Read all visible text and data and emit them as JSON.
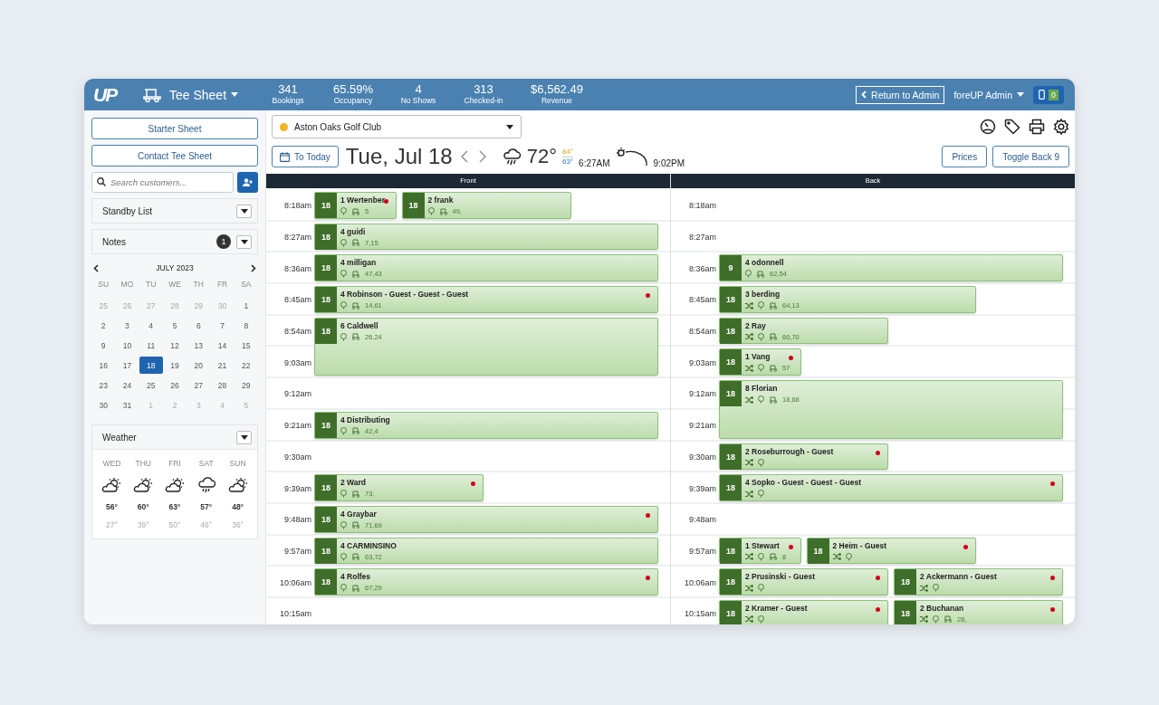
{
  "header": {
    "logo": "UP",
    "app_menu": "Tee Sheet",
    "stats": [
      {
        "value": "341",
        "label": "Bookings"
      },
      {
        "value": "65.59%",
        "label": "Occupancy"
      },
      {
        "value": "4",
        "label": "No Shows"
      },
      {
        "value": "313",
        "label": "Checked-in"
      },
      {
        "value": "$6,562.49",
        "label": "Revenue"
      }
    ],
    "return_button": "Return to Admin",
    "user_menu": "foreUP Admin",
    "device_count": "0"
  },
  "sidebar": {
    "buttons": [
      "Starter Sheet",
      "Contact Tee Sheet"
    ],
    "search": {
      "placeholder": "Search customers..."
    },
    "panels": [
      {
        "title": "Standby List"
      },
      {
        "title": "Notes",
        "count": "1"
      }
    ],
    "calendar": {
      "month": "JULY  2023",
      "weekdays": [
        "SU",
        "MO",
        "TU",
        "WE",
        "TH",
        "FR",
        "SA"
      ],
      "days": [
        {
          "label": "25",
          "muted": true,
          "selected": false
        },
        {
          "label": "26",
          "muted": true,
          "selected": false
        },
        {
          "label": "27",
          "muted": true,
          "selected": false
        },
        {
          "label": "28",
          "muted": true,
          "selected": false
        },
        {
          "label": "29",
          "muted": true,
          "selected": false
        },
        {
          "label": "30",
          "muted": true,
          "selected": false
        },
        {
          "label": "1",
          "muted": false,
          "selected": false
        },
        {
          "label": "2",
          "muted": false,
          "selected": false
        },
        {
          "label": "3",
          "muted": false,
          "selected": false
        },
        {
          "label": "4",
          "muted": false,
          "selected": false
        },
        {
          "label": "5",
          "muted": false,
          "selected": false
        },
        {
          "label": "6",
          "muted": false,
          "selected": false
        },
        {
          "label": "7",
          "muted": false,
          "selected": false
        },
        {
          "label": "8",
          "muted": false,
          "selected": false
        },
        {
          "label": "9",
          "muted": false,
          "selected": false
        },
        {
          "label": "10",
          "muted": false,
          "selected": false
        },
        {
          "label": "11",
          "muted": false,
          "selected": false
        },
        {
          "label": "12",
          "muted": false,
          "selected": false
        },
        {
          "label": "13",
          "muted": false,
          "selected": false
        },
        {
          "label": "14",
          "muted": false,
          "selected": false
        },
        {
          "label": "15",
          "muted": false,
          "selected": false
        },
        {
          "label": "16",
          "muted": false,
          "selected": false
        },
        {
          "label": "17",
          "muted": false,
          "selected": false
        },
        {
          "label": "18",
          "muted": false,
          "selected": true
        },
        {
          "label": "19",
          "muted": false,
          "selected": false
        },
        {
          "label": "20",
          "muted": false,
          "selected": false
        },
        {
          "label": "21",
          "muted": false,
          "selected": false
        },
        {
          "label": "22",
          "muted": false,
          "selected": false
        },
        {
          "label": "23",
          "muted": false,
          "selected": false
        },
        {
          "label": "24",
          "muted": false,
          "selected": false
        },
        {
          "label": "25",
          "muted": false,
          "selected": false
        },
        {
          "label": "26",
          "muted": false,
          "selected": false
        },
        {
          "label": "27",
          "muted": false,
          "selected": false
        },
        {
          "label": "28",
          "muted": false,
          "selected": false
        },
        {
          "label": "29",
          "muted": false,
          "selected": false
        },
        {
          "label": "30",
          "muted": false,
          "selected": false
        },
        {
          "label": "31",
          "muted": false,
          "selected": false
        },
        {
          "label": "1",
          "muted": true,
          "selected": false
        },
        {
          "label": "2",
          "muted": true,
          "selected": false
        },
        {
          "label": "3",
          "muted": true,
          "selected": false
        },
        {
          "label": "4",
          "muted": true,
          "selected": false
        },
        {
          "label": "5",
          "muted": true,
          "selected": false
        }
      ]
    },
    "weather": {
      "title": "Weather",
      "days": [
        {
          "day": "WED",
          "kind": "partly_cloudy",
          "high": "56°",
          "low": "27°"
        },
        {
          "day": "THU",
          "kind": "partly_cloudy",
          "high": "60°",
          "low": "39°"
        },
        {
          "day": "FRI",
          "kind": "partly_cloudy",
          "high": "63°",
          "low": "50°"
        },
        {
          "day": "SAT",
          "kind": "rain",
          "high": "57°",
          "low": "46°"
        },
        {
          "day": "SUN",
          "kind": "partly_cloudy",
          "high": "48°",
          "low": "36°"
        }
      ]
    }
  },
  "toolbar": {
    "course": {
      "name": "Aston Oaks Golf Club",
      "color": "#f0b429"
    },
    "today_button": "To Today",
    "date": "Tue, Jul 18",
    "temperature": "72°",
    "high": "84°",
    "low": "63°",
    "sunrise": "6:27AM",
    "sunset": "9:02PM",
    "buttons": [
      "Prices",
      "Toggle Back 9"
    ]
  },
  "sheet": {
    "columns": [
      {
        "title": "Front",
        "rows": [
          {
            "time": "8:18am",
            "bookings": [
              {
                "holes": "18",
                "name": "1 Wertenber",
                "kind": "quarter",
                "flag": true,
                "shuffle": false,
                "cart": "5"
              },
              {
                "holes": "18",
                "name": "2 frank",
                "kind": "half",
                "flag": false,
                "shuffle": false,
                "cart": "49,"
              }
            ]
          },
          {
            "time": "8:27am",
            "bookings": [
              {
                "holes": "18",
                "name": "4 guidi",
                "kind": "full",
                "flag": false,
                "shuffle": false,
                "cart": "7,15"
              }
            ]
          },
          {
            "time": "8:36am",
            "bookings": [
              {
                "holes": "18",
                "name": "4 milligan",
                "kind": "full",
                "flag": false,
                "shuffle": false,
                "cart": "47,43"
              }
            ]
          },
          {
            "time": "8:45am",
            "bookings": [
              {
                "holes": "18",
                "name": "4 Robinson - Guest - Guest - Guest",
                "kind": "full",
                "flag": true,
                "shuffle": false,
                "cart": "14,61"
              }
            ]
          },
          {
            "time": "8:54am",
            "bookings": [
              {
                "holes": "18",
                "name": "6 Caldwell",
                "kind": "double",
                "flag": false,
                "shuffle": false,
                "cart": "26,24"
              }
            ]
          },
          {
            "time": "9:03am"
          },
          {
            "time": "9:12am"
          },
          {
            "time": "9:21am",
            "bookings": [
              {
                "holes": "18",
                "name": "4 Distributing",
                "kind": "full",
                "flag": false,
                "shuffle": false,
                "cart": "42,4"
              }
            ]
          },
          {
            "time": "9:30am"
          },
          {
            "time": "9:39am",
            "bookings": [
              {
                "holes": "18",
                "name": "2 Ward",
                "kind": "half",
                "flag": true,
                "shuffle": false,
                "cart": "73,"
              }
            ]
          },
          {
            "time": "9:48am",
            "bookings": [
              {
                "holes": "18",
                "name": "4 Graybar",
                "kind": "full",
                "flag": true,
                "shuffle": false,
                "cart": "71,69"
              }
            ]
          },
          {
            "time": "9:57am",
            "bookings": [
              {
                "holes": "18",
                "name": "4 CARMINSINO",
                "kind": "full",
                "flag": false,
                "shuffle": false,
                "cart": "63,72"
              }
            ]
          },
          {
            "time": "10:06am",
            "bookings": [
              {
                "holes": "18",
                "name": "4 Rolfes",
                "kind": "full",
                "flag": true,
                "shuffle": false,
                "cart": "67,29"
              }
            ]
          },
          {
            "time": "10:15am"
          }
        ]
      },
      {
        "title": "Back",
        "rows": [
          {
            "time": "8:18am"
          },
          {
            "time": "8:27am"
          },
          {
            "time": "8:36am",
            "bookings": [
              {
                "holes": "9",
                "name": "4 odonnell",
                "kind": "full",
                "flag": false,
                "shuffle": false,
                "cart": "62,54"
              }
            ]
          },
          {
            "time": "8:45am",
            "bookings": [
              {
                "holes": "18",
                "name": "3 berding",
                "kind": "three_quarters",
                "flag": false,
                "shuffle": true,
                "cart": "64,13"
              }
            ]
          },
          {
            "time": "8:54am",
            "bookings": [
              {
                "holes": "18",
                "name": "2 Ray",
                "kind": "half",
                "flag": false,
                "shuffle": true,
                "cart": "60,70"
              }
            ]
          },
          {
            "time": "9:03am",
            "bookings": [
              {
                "holes": "18",
                "name": "1 Vang",
                "kind": "quarter",
                "flag": true,
                "shuffle": true,
                "cart": "57"
              }
            ]
          },
          {
            "time": "9:12am",
            "bookings": [
              {
                "holes": "18",
                "name": "8 Florian",
                "kind": "double",
                "flag": false,
                "shuffle": true,
                "cart": "18,68"
              }
            ]
          },
          {
            "time": "9:21am"
          },
          {
            "time": "9:30am",
            "bookings": [
              {
                "holes": "18",
                "name": "2 Roseburrough - Guest",
                "kind": "half",
                "flag": true,
                "shuffle": true
              }
            ]
          },
          {
            "time": "9:39am",
            "bookings": [
              {
                "holes": "18",
                "name": "4 Sopko - Guest - Guest - Guest",
                "kind": "full",
                "flag": true,
                "shuffle": true
              }
            ]
          },
          {
            "time": "9:48am"
          },
          {
            "time": "9:57am",
            "bookings": [
              {
                "holes": "18",
                "name": "1 Stewart",
                "kind": "quarter",
                "flag": true,
                "shuffle": true,
                "cart": "8"
              },
              {
                "holes": "18",
                "name": "2 Heim - Guest",
                "kind": "half",
                "flag": true,
                "shuffle": true
              }
            ]
          },
          {
            "time": "10:06am",
            "bookings": [
              {
                "holes": "18",
                "name": "2 Prusinski - Guest",
                "kind": "half",
                "flag": true,
                "shuffle": true
              },
              {
                "holes": "18",
                "name": "2 Ackermann - Guest",
                "kind": "half",
                "flag": true,
                "shuffle": true
              }
            ]
          },
          {
            "time": "10:15am",
            "bookings": [
              {
                "holes": "18",
                "name": "2 Kramer - Guest",
                "kind": "half",
                "flag": true,
                "shuffle": true
              },
              {
                "holes": "18",
                "name": "2 Buchanan",
                "kind": "half",
                "flag": true,
                "shuffle": true,
                "cart": "28,"
              }
            ]
          }
        ]
      }
    ]
  }
}
